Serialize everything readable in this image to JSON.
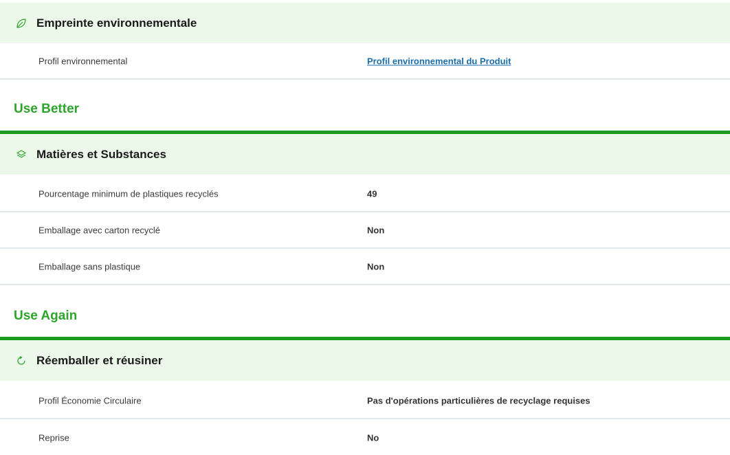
{
  "sections": [
    {
      "icon": "leaf-icon",
      "title": "Empreinte environnementale",
      "rows": [
        {
          "label": "Profil environnemental",
          "value": "Profil environnemental du Produit",
          "link": true
        }
      ]
    },
    {
      "group_title": "Use Better",
      "icon": "layers-icon",
      "title": "Matières et Substances",
      "rows": [
        {
          "label": "Pourcentage minimum de plastiques recyclés",
          "value": "49"
        },
        {
          "label": "Emballage avec carton recyclé",
          "value": "Non"
        },
        {
          "label": "Emballage sans plastique",
          "value": "Non"
        }
      ]
    },
    {
      "group_title": "Use Again",
      "icon": "refresh-icon",
      "title": "Réemballer et réusiner",
      "rows": [
        {
          "label": "Profil Économie Circulaire",
          "value": "Pas d'opérations particulières de recyclage requises"
        },
        {
          "label": "Reprise",
          "value": "No"
        }
      ]
    }
  ],
  "colors": {
    "header_bg": "#ecf9ea",
    "group_title": "#2ca52a",
    "green_rule": "#1a9a1f",
    "link": "#1b6fa8",
    "divider": "#e3e6e8"
  }
}
